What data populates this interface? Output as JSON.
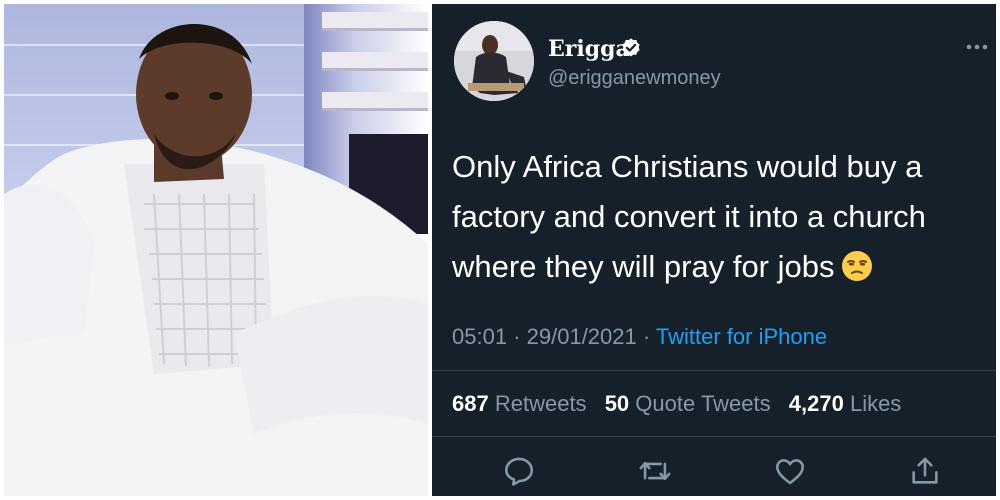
{
  "tweet": {
    "display_name": "Erigga",
    "username": "@erigganewmoney",
    "text": "Only Africa Christians would buy a factory and convert it into a church where they will pray for jobs",
    "emoji": "unamused-face-emoji",
    "time": "05:01",
    "separator": "·",
    "date": "29/01/2021",
    "source": "Twitter for iPhone",
    "retweets_count": "687",
    "retweets_label": "Retweets",
    "quote_count": "50",
    "quote_label": "Quote Tweets",
    "likes_count": "4,270",
    "likes_label": "Likes"
  },
  "icons": {
    "verified": "verified-badge-icon",
    "more": "more-options-icon",
    "reply": "reply-icon",
    "retweet": "retweet-icon",
    "like": "like-icon",
    "share": "share-icon"
  },
  "colors": {
    "background": "#15202b",
    "text": "#ffffff",
    "secondary": "#8899a6",
    "accent": "#1da1f2",
    "divider": "#38444d"
  }
}
